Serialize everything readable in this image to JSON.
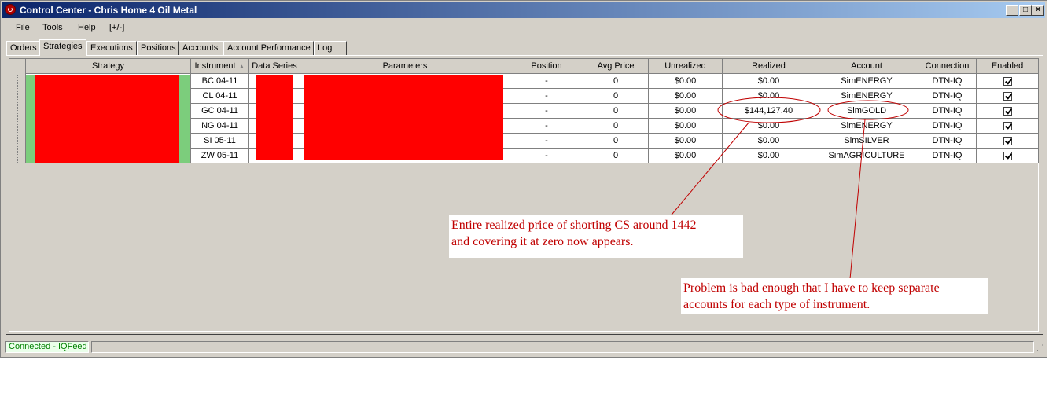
{
  "window": {
    "title": "Control Center - Chris Home 4 Oil Metal"
  },
  "menu": [
    "File",
    "Tools",
    "Help",
    "[+/-]"
  ],
  "tabs": [
    "Orders",
    "Strategies",
    "Executions",
    "Positions",
    "Accounts",
    "Account Performance",
    "Log"
  ],
  "active_tab": "Strategies",
  "table": {
    "columns": [
      "Strategy",
      "Instrument",
      "Data Series",
      "Parameters",
      "Position",
      "Avg Price",
      "Unrealized",
      "Realized",
      "Account",
      "Connection",
      "Enabled"
    ],
    "rows": [
      {
        "instrument": "BC 04-11",
        "position": "-",
        "avg_price": "0",
        "unrealized": "$0.00",
        "realized": "$0.00",
        "account": "SimENERGY",
        "connection": "DTN-IQ",
        "enabled": true
      },
      {
        "instrument": "CL 04-11",
        "position": "-",
        "avg_price": "0",
        "unrealized": "$0.00",
        "realized": "$0.00",
        "account": "SimENERGY",
        "connection": "DTN-IQ",
        "enabled": true
      },
      {
        "instrument": "GC 04-11",
        "position": "-",
        "avg_price": "0",
        "unrealized": "$0.00",
        "realized": "$144,127.40",
        "account": "SimGOLD",
        "connection": "DTN-IQ",
        "enabled": true
      },
      {
        "instrument": "NG 04-11",
        "position": "-",
        "avg_price": "0",
        "unrealized": "$0.00",
        "realized": "$0.00",
        "account": "SimENERGY",
        "connection": "DTN-IQ",
        "enabled": true
      },
      {
        "instrument": "SI 05-11",
        "position": "-",
        "avg_price": "0",
        "unrealized": "$0.00",
        "realized": "$0.00",
        "account": "SimSILVER",
        "connection": "DTN-IQ",
        "enabled": true
      },
      {
        "instrument": "ZW 05-11",
        "position": "-",
        "avg_price": "0",
        "unrealized": "$0.00",
        "realized": "$0.00",
        "account": "SimAGRICULTURE",
        "connection": "DTN-IQ",
        "enabled": true
      }
    ]
  },
  "annotations": {
    "note1": [
      "Entire realized price of shorting CS around 1442",
      "and covering it at zero now appears."
    ],
    "note2": [
      "Problem is bad enough that I have to keep separate",
      "accounts for each type of instrument."
    ]
  },
  "status": {
    "connection": "Connected - IQFeed"
  },
  "colors": {
    "redaction": "#ff0000",
    "strategy_marker": "#7ccd7c",
    "annotation": "#c00000",
    "status_text": "#008000"
  }
}
